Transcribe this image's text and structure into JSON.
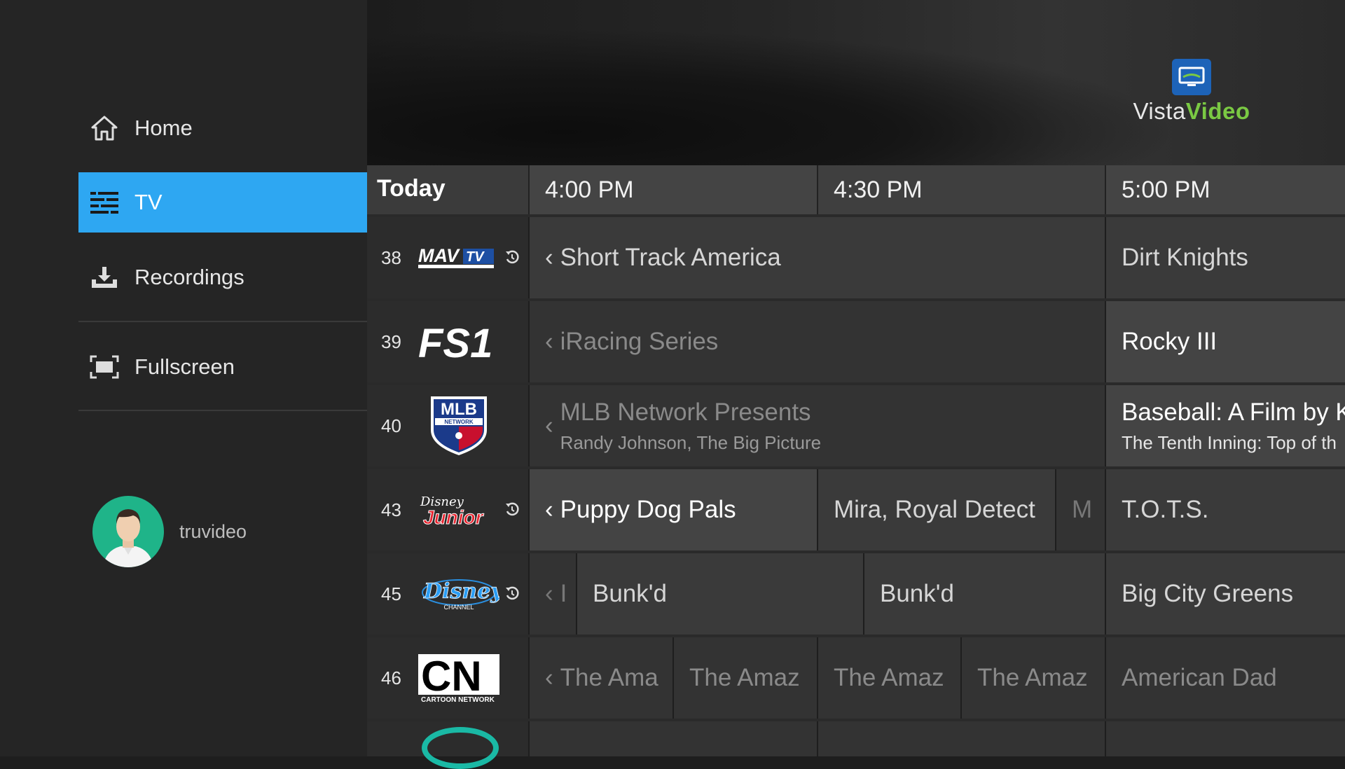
{
  "sidebar": {
    "items": [
      {
        "label": "Home",
        "icon": "home-icon"
      },
      {
        "label": "TV",
        "icon": "tv-guide-icon",
        "active": true
      },
      {
        "label": "Recordings",
        "icon": "recordings-icon"
      },
      {
        "label": "Fullscreen",
        "icon": "fullscreen-icon"
      }
    ],
    "username": "truvideo"
  },
  "logo": {
    "part1": "Vista",
    "part2": "Video"
  },
  "guide": {
    "day": "Today",
    "times": [
      "4:00 PM",
      "4:30 PM",
      "5:00 PM"
    ],
    "channels": [
      {
        "number": "38",
        "name": "MAVTV",
        "programs": [
          {
            "title": "Short Track America"
          },
          {
            "title": "Dirt Knights"
          }
        ]
      },
      {
        "number": "39",
        "name": "FS1",
        "programs": [
          {
            "title": "iRacing Series"
          },
          {
            "title": "Rocky III"
          }
        ]
      },
      {
        "number": "40",
        "name": "MLB Network",
        "programs": [
          {
            "title": "MLB Network Presents",
            "subtitle": "Randy Johnson, The Big Picture"
          },
          {
            "title": "Baseball: A Film by K",
            "subtitle": "The Tenth Inning: Top of th"
          }
        ]
      },
      {
        "number": "43",
        "name": "Disney Junior",
        "programs": [
          {
            "title": "Puppy Dog Pals"
          },
          {
            "title": "Mira, Royal Detect"
          },
          {
            "title": "M"
          },
          {
            "title": "T.O.T.S."
          }
        ]
      },
      {
        "number": "45",
        "name": "Disney Channel",
        "programs": [
          {
            "title": "I"
          },
          {
            "title": "Bunk'd"
          },
          {
            "title": "Bunk'd"
          },
          {
            "title": "Big City Greens"
          }
        ]
      },
      {
        "number": "46",
        "name": "Cartoon Network",
        "programs": [
          {
            "title": "The Ama"
          },
          {
            "title": "The Amaz"
          },
          {
            "title": "The Amaz"
          },
          {
            "title": "The Amaz"
          },
          {
            "title": "American Dad"
          }
        ]
      }
    ]
  },
  "colors": {
    "accent": "#2ea7f2",
    "brand_green": "#7ac943",
    "brand_blue": "#1d63b8",
    "avatar_bg": "#1fb489"
  }
}
